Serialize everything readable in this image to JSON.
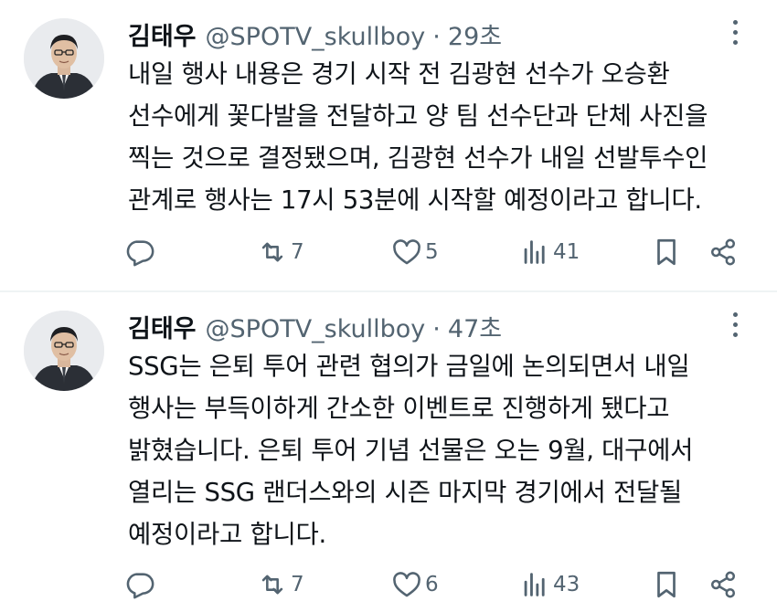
{
  "tweets": [
    {
      "author_name": "김태우",
      "handle": "@SPOTV_skullboy",
      "separator": "·",
      "time": "29초",
      "lines": [
        "내일 행사 내용은 경기 시작 전 김광현 선수가 오승환",
        "선수에게 꽃다발을 전달하고 양 팀 선수단과 단체 사진을",
        "찍는 것으로 결정됐으며, 김광현 선수가 내일 선발투수인",
        "관계로 행사는 17시 53분에 시작할 예정이라고 합니다."
      ],
      "reply_count": "",
      "retweet_count": "7",
      "like_count": "5",
      "view_count": "41",
      "icons": [
        "reply-icon",
        "retweet-icon",
        "like-icon",
        "views-icon",
        "bookmark-icon",
        "share-icon",
        "more-icon"
      ]
    },
    {
      "author_name": "김태우",
      "handle": "@SPOTV_skullboy",
      "separator": "·",
      "time": "47초",
      "lines": [
        "SSG는 은퇴 투어 관련 협의가 금일에 논의되면서 내일",
        "행사는 부득이하게 간소한 이벤트로 진행하게 됐다고",
        "밝혔습니다. 은퇴 투어 기념 선물은 오는 9월, 대구에서",
        "열리는 SSG 랜더스와의 시즌 마지막 경기에서 전달될",
        "예정이라고 합니다."
      ],
      "reply_count": "",
      "retweet_count": "7",
      "like_count": "6",
      "view_count": "43",
      "icons": [
        "reply-icon",
        "retweet-icon",
        "like-icon",
        "views-icon",
        "bookmark-icon",
        "share-icon",
        "more-icon"
      ]
    }
  ],
  "colors": {
    "text": "#0f1419",
    "secondary": "#536471",
    "divider": "#eff3f4",
    "background": "#ffffff"
  }
}
